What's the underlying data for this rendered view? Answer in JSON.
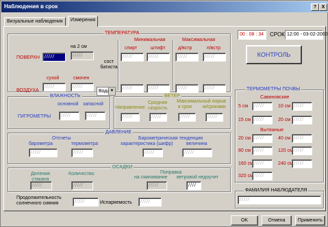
{
  "window": {
    "title": "Наблюдения в срок",
    "help_label": "?",
    "close_label": "X"
  },
  "tabs": [
    {
      "label": "Визуальные наблюдения"
    },
    {
      "label": "Измерения"
    }
  ],
  "status": {
    "time": "00 : 08 : 34",
    "srok_label": "СРОК",
    "srok_value": "12:00 - 03-02-2000"
  },
  "kontrol_label": "КОНТРОЛЬ",
  "temperature": {
    "legend": "ТЕМПЕРАТУРА",
    "surface_label": "ПОВЕРХН",
    "air_label": "ВОЗДУХА",
    "na2cm": "на 2 см",
    "dry": "сухой",
    "wet": "смочен",
    "sost_batista": "сост батиста",
    "combo_value": "Вода",
    "min_label": "Минимальная",
    "spirt": "спирт",
    "shtift": "штифт",
    "max_label": "Максимальная",
    "d_vstr": "д/встр",
    "p_vstr": "п/встр"
  },
  "humidity": {
    "legend": "ВЛАЖНОСТЬ",
    "main": "основной",
    "spare": "запасной",
    "hygrometers": "ГИГРОМЕТРЫ"
  },
  "wind": {
    "legend": "ВЕТЕР",
    "direction": "Направление",
    "avg_speed": "Средняя скорость",
    "max_gust": "Максимальный порыв",
    "in_srok": "в срок",
    "between": "м/сроками"
  },
  "pressure": {
    "legend": "ДАВЛЕНИЕ",
    "readings": "Отсчеты",
    "barometer": "барометра",
    "thermometer": "термометра",
    "tendency": "Барометрическая тенденция",
    "characteristic": "характеристика (шифр)",
    "value": "величина"
  },
  "precip": {
    "legend": "ОСАДКИ",
    "days": "Деления стакана",
    "amount": "Количество",
    "corrections": "Поправка",
    "wetting": "на смачивание",
    "wind_deficit": "ветровой недоучет",
    "deficit_value": "////"
  },
  "sunshine_label": "Продолжительность солнечного сияния",
  "evaporation_label": "Испаряемость",
  "soil": {
    "legend": "ТЕРМОМЕТРЫ ПОЧВЫ",
    "savinov": "Савиновские",
    "s5": "5 см",
    "s10": "10 см",
    "s15": "15 см",
    "s20": "20 см",
    "vytyazh": "Вытяжные",
    "v20": "20 см",
    "v40": "40 см",
    "v80": "80 см",
    "v120": "120 см",
    "v160": "160 см",
    "v240": "240 см",
    "v320": "320 см"
  },
  "observer": {
    "legend": "ФАМИЛИЯ НАБЛЮДАТЕЛЯ"
  },
  "buttons": {
    "ok": "OK",
    "cancel": "Отмена",
    "apply": "Применить"
  },
  "placeholder": "/////"
}
